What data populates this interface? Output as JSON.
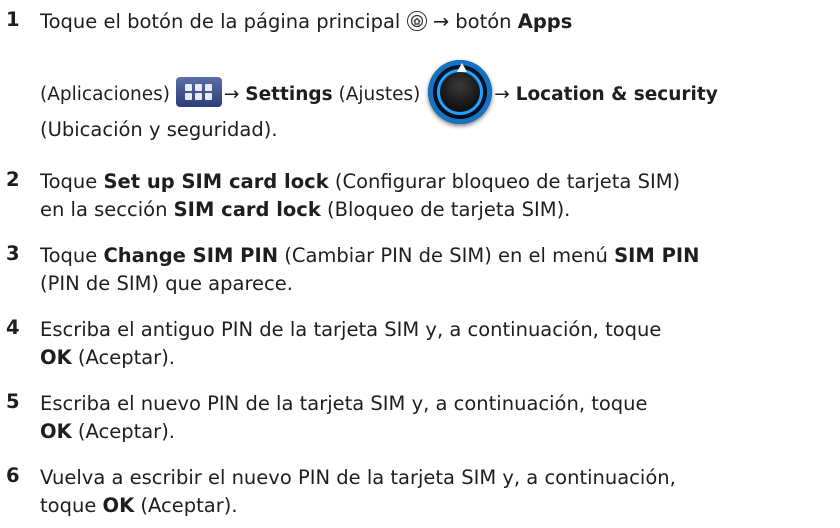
{
  "steps": [
    {
      "num": "1",
      "l1_a": "Toque el botón de la página principal",
      "l1_b": "→ botón",
      "l1_apps": "Apps",
      "l2_a": "(Aplicaciones)",
      "l2_arrow1": "→",
      "l2_settings": "Settings",
      "l2_b": "(Ajustes)",
      "l2_arrow2": "→",
      "l2_location": "Location & security",
      "l3": "(Ubicación y seguridad)."
    },
    {
      "num": "2",
      "l1_a": "Toque",
      "l1_bold": "Set up SIM card lock",
      "l1_b": "(Configurar bloqueo de tarjeta SIM)",
      "l2_a": "en la sección",
      "l2_bold": "SIM card lock",
      "l2_b": "(Bloqueo de tarjeta SIM)."
    },
    {
      "num": "3",
      "l1_a": "Toque",
      "l1_bold": "Change SIM PIN",
      "l1_b": "(Cambiar PIN de SIM) en el menú",
      "l1_bold2": "SIM PIN",
      "l2": "(PIN de SIM) que aparece."
    },
    {
      "num": "4",
      "l1": "Escriba el antiguo PIN de la tarjeta SIM y, a continuación, toque",
      "l2_bold": "OK",
      "l2_b": "(Aceptar)."
    },
    {
      "num": "5",
      "l1": "Escriba el nuevo PIN de la tarjeta SIM y, a continuación, toque",
      "l2_bold": "OK",
      "l2_b": "(Aceptar)."
    },
    {
      "num": "6",
      "l1": "Vuelva a escribir el nuevo PIN de la tarjeta SIM y, a continuación,",
      "l2_a": "toque",
      "l2_bold": "OK",
      "l2_b": "(Aceptar)."
    }
  ],
  "icons": {
    "home": "home-icon",
    "apps": "apps-grid-icon",
    "settings": "settings-dial-icon"
  },
  "colors": {
    "settings_blue": "#21a0ff",
    "apps_blue": "#3a4f8c"
  }
}
